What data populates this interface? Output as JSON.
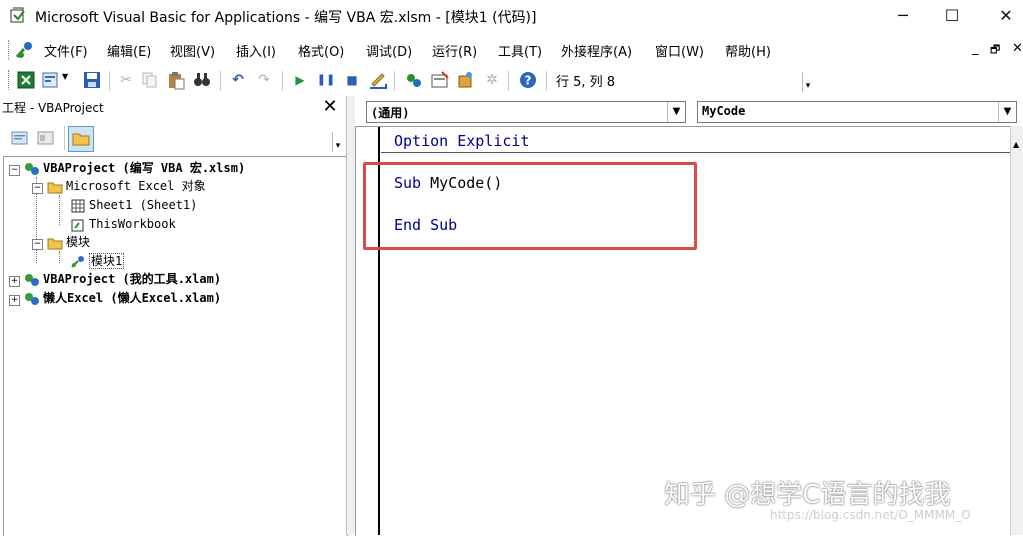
{
  "window": {
    "title": "Microsoft Visual Basic for Applications - 编写 VBA 宏.xlsm - [模块1 (代码)]",
    "controls": {
      "minimize": "─",
      "maximize": "☐",
      "close": "✕"
    }
  },
  "menu": {
    "items": [
      "文件(F)",
      "编辑(E)",
      "视图(V)",
      "插入(I)",
      "格式(O)",
      "调试(D)",
      "运行(R)",
      "工具(T)",
      "外接程序(A)",
      "窗口(W)",
      "帮助(H)"
    ],
    "doc_controls": {
      "minimize": "_",
      "restore": "🗗",
      "close": "✕"
    }
  },
  "toolbar": {
    "status_position": "行 5, 列 8"
  },
  "project_panel": {
    "title": "工程 - VBAProject",
    "close": "✕",
    "tree": [
      {
        "label_bold": "VBAProject (编写 VBA 宏.xlsm)",
        "expander": "−"
      },
      {
        "label": "Microsoft Excel 对象",
        "expander": "−"
      },
      {
        "label": "Sheet1 (Sheet1)"
      },
      {
        "label": "ThisWorkbook"
      },
      {
        "label": "模块",
        "expander": "−"
      },
      {
        "label": "模块1"
      },
      {
        "label_bold": "VBAProject (我的工具.xlam)",
        "expander": "+"
      },
      {
        "label_bold": "懒人Excel (懒人Excel.xlam)",
        "expander": "+"
      }
    ]
  },
  "code_window": {
    "object_combo": "(通用)",
    "procedure_combo": "MyCode",
    "lines": {
      "option": "Option Explicit",
      "sub_kw": "Sub",
      "sub_name": " MyCode()",
      "end_sub": "End Sub"
    },
    "highlight_color": "#e0484d"
  },
  "watermark": {
    "main": "知乎 @想学C语言的找我",
    "url": "https://blog.csdn.net/O_MMMM_O"
  }
}
